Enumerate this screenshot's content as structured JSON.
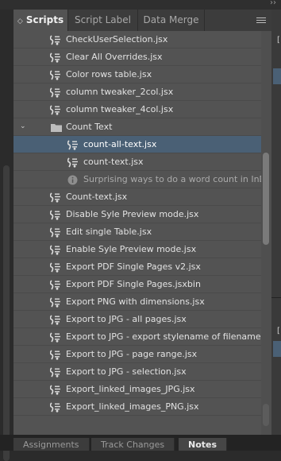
{
  "top": {
    "collapse_glyph": "››"
  },
  "tabs": [
    {
      "label": "Scripts",
      "active": true
    },
    {
      "label": "Script Label",
      "active": false
    },
    {
      "label": "Data Merge",
      "active": false
    }
  ],
  "tab_arrows": "◇",
  "items": [
    {
      "label": "CheckUserSelection.jsx",
      "kind": "script",
      "indent": 0
    },
    {
      "label": "Clear All Overrides.jsx",
      "kind": "script",
      "indent": 0
    },
    {
      "label": "Color rows table.jsx",
      "kind": "script",
      "indent": 0
    },
    {
      "label": "column tweaker_2col.jsx",
      "kind": "script",
      "indent": 0
    },
    {
      "label": "column tweaker_4col.jsx",
      "kind": "script",
      "indent": 0
    },
    {
      "label": "Count Text",
      "kind": "folder",
      "indent": 0,
      "expanded": true
    },
    {
      "label": "count-all-text.jsx",
      "kind": "script",
      "indent": 1,
      "selected": true
    },
    {
      "label": "count-text.jsx",
      "kind": "script",
      "indent": 1
    },
    {
      "label": "Surprising ways to do a word count in InDe...",
      "kind": "info",
      "indent": 1
    },
    {
      "label": "Count-text.jsx",
      "kind": "script",
      "indent": 0
    },
    {
      "label": "Disable Syle Preview mode.jsx",
      "kind": "script",
      "indent": 0
    },
    {
      "label": "Edit single Table.jsx",
      "kind": "script",
      "indent": 0
    },
    {
      "label": "Enable Syle Preview mode.jsx",
      "kind": "script",
      "indent": 0
    },
    {
      "label": "Export PDF Single Pages v2.jsx",
      "kind": "script",
      "indent": 0
    },
    {
      "label": "Export PDF Single Pages.jsxbin",
      "kind": "script",
      "indent": 0
    },
    {
      "label": "Export PNG with dimensions.jsx",
      "kind": "script",
      "indent": 0
    },
    {
      "label": "Export to JPG - all pages.jsx",
      "kind": "script",
      "indent": 0
    },
    {
      "label": "Export to JPG - export stylename of filename.jsx",
      "kind": "script",
      "indent": 0
    },
    {
      "label": "Export to JPG - page range.jsx",
      "kind": "script",
      "indent": 0
    },
    {
      "label": "Export to JPG - selection.jsx",
      "kind": "script",
      "indent": 0
    },
    {
      "label": "Export_linked_images_JPG.jsx",
      "kind": "script",
      "indent": 0
    },
    {
      "label": "Export_linked_images_PNG.jsx",
      "kind": "script",
      "indent": 0
    }
  ],
  "bottom_tabs": [
    {
      "label": "Assignments",
      "active": false
    },
    {
      "label": "Track Changes",
      "active": false
    },
    {
      "label": "Notes",
      "active": true
    }
  ],
  "right_side": {
    "bracket_glyph": "["
  },
  "colors": {
    "selection": "#4a6075",
    "panel": "#535353",
    "tab_bar": "#3c3c3c"
  }
}
